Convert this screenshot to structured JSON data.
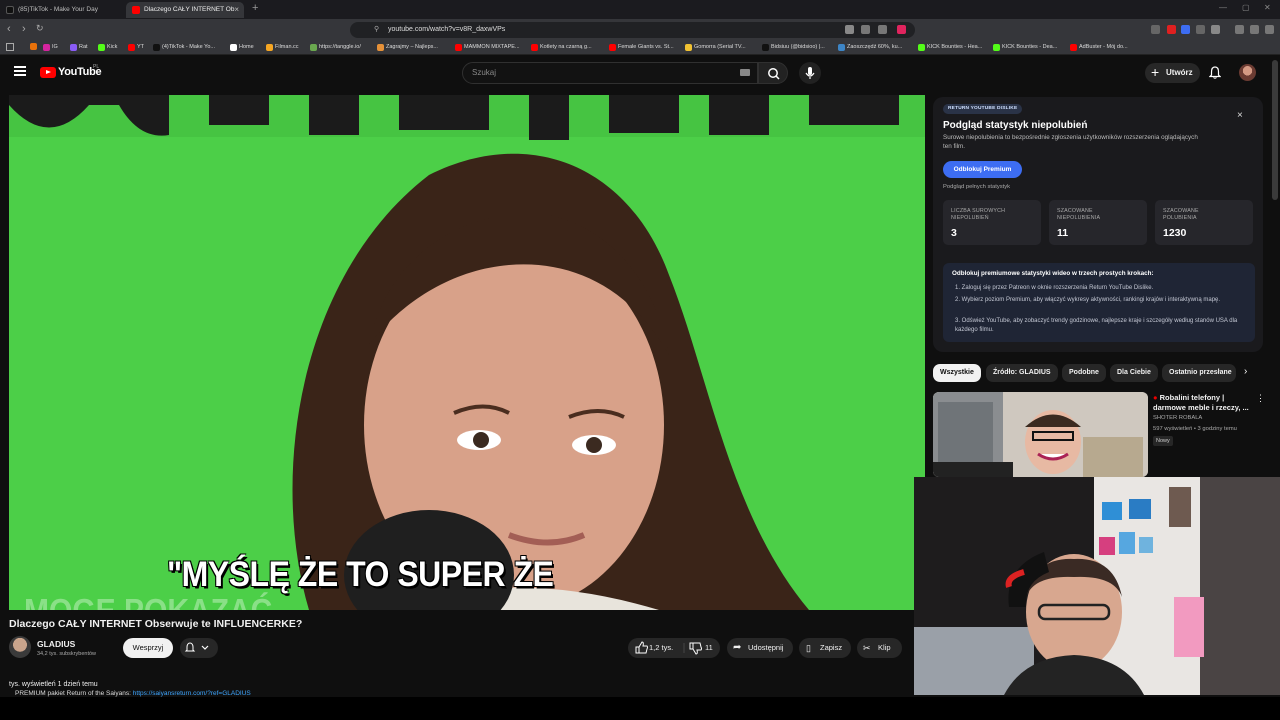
{
  "browser": {
    "tabs": [
      {
        "title": "(85)TikTok - Make Your Day",
        "active": false
      },
      {
        "title": "Dlaczego CAŁY INTERNET Ob",
        "active": true
      }
    ],
    "new_tab": "+",
    "url": "youtube.com/watch?v=v8R_daxwVPs",
    "bookmarks": [
      {
        "label": "IG",
        "color": "#d6249f"
      },
      {
        "label": "Rat",
        "color": "#8a5cf6"
      },
      {
        "label": "Kick",
        "color": "#53fc18"
      },
      {
        "label": "YT",
        "color": "#ff0000"
      },
      {
        "label": "(4)TikTok - Make Yo...",
        "color": "#111111"
      },
      {
        "label": "Home",
        "color": "#ffffff"
      },
      {
        "label": "Filman.cc",
        "color": "#f5a623"
      },
      {
        "label": "https://tanggle.io/",
        "color": "#6aa84f"
      },
      {
        "label": "Zagrajmy – Najleps...",
        "color": "#e69138"
      },
      {
        "label": "MAMMON MIXTAPE...",
        "color": "#ff0000"
      },
      {
        "label": "Kotlety na czarną g...",
        "color": "#ff0000"
      },
      {
        "label": "Female Giants vs. St...",
        "color": "#ff0000"
      },
      {
        "label": "Gomorra (Serial TV...",
        "color": "#f1c232"
      },
      {
        "label": "Bidsiuu (@bidsioo) |...",
        "color": "#111111"
      },
      {
        "label": "Zaoszczędź 60%, ku...",
        "color": "#3d85c6"
      },
      {
        "label": "KICK Bounties - Hea...",
        "color": "#53fc18"
      },
      {
        "label": "KICK Bounties - Dea...",
        "color": "#53fc18"
      },
      {
        "label": "AdBuster - Mój do...",
        "color": "#ff0000"
      }
    ]
  },
  "youtube": {
    "logo_text": "YouTube",
    "region": "PL",
    "search_placeholder": "Szukaj",
    "create_label": "Utwórz"
  },
  "video": {
    "caption_main": "\"MYŚLĘ ŻE TO SUPER ŻE",
    "caption_faded": "MOGĘ POKAZAĆ",
    "title": "Dlaczego CAŁY INTERNET Obserwuje te INFLUENCERKE?",
    "channel": "GLADIUS",
    "subscribers": "34,2 tys. subskrybentów",
    "support_label": "Wesprzyj",
    "likes": "1,2 tys.",
    "dislikes": "11",
    "share_label": "Udostępnij",
    "save_label": "Zapisz",
    "clip_label": "Klip",
    "desc_line1": "tys. wyświetleń  1 dzień temu",
    "desc_line2": "PREMIUM pakiet Return of the Saiyans:",
    "desc_link": "https://saiyansreturn.com/?ref=GLADIUS"
  },
  "ryd": {
    "badge": "RETURN YOUTUBE DISLIKE",
    "close": "×",
    "title": "Podgląd statystyk niepolubień",
    "subtitle": "Surowe niepolubienia to bezpośrednie zgłoszenia użytkowników rozszerzenia oglądających ten film.",
    "unlock_label": "Odblokuj Premium",
    "preview_label": "Podgląd pełnych statystyk",
    "stats": [
      {
        "label": "LICZBA SUROWYCH NIEPOLUBIEŃ",
        "value": "3"
      },
      {
        "label": "SZACOWANE NIEPOLUBIENIA",
        "value": "11"
      },
      {
        "label": "SZACOWANE POLUBIENIA",
        "value": "1230"
      }
    ],
    "steps_title": "Odblokuj premiumowe statystyki wideo w trzech prostych krokach:",
    "steps": [
      "1.  Zaloguj się przez Patreon w oknie rozszerzenia Return YouTube Dislike.",
      "2.  Wybierz poziom Premium, aby włączyć wykresy aktywności, rankingi krajów i interaktywną mapę.",
      "3.  Odśwież YouTube, aby zobaczyć trendy godzinowe, najlepsze kraje i szczegóły według stanów USA dla każdego filmu."
    ]
  },
  "chips": [
    "Wszystkie",
    "Źródło: GLADIUS",
    "Podobne",
    "Dla Ciebie",
    "Ostatnio przesłane"
  ],
  "recommended": {
    "title": "Robalini telefony | darmowe meble i rzeczy, ...",
    "channel": "SHOTER ROBALA",
    "meta": "597 wyświetleń • 3 godziny temu",
    "badge": "Nowy"
  }
}
